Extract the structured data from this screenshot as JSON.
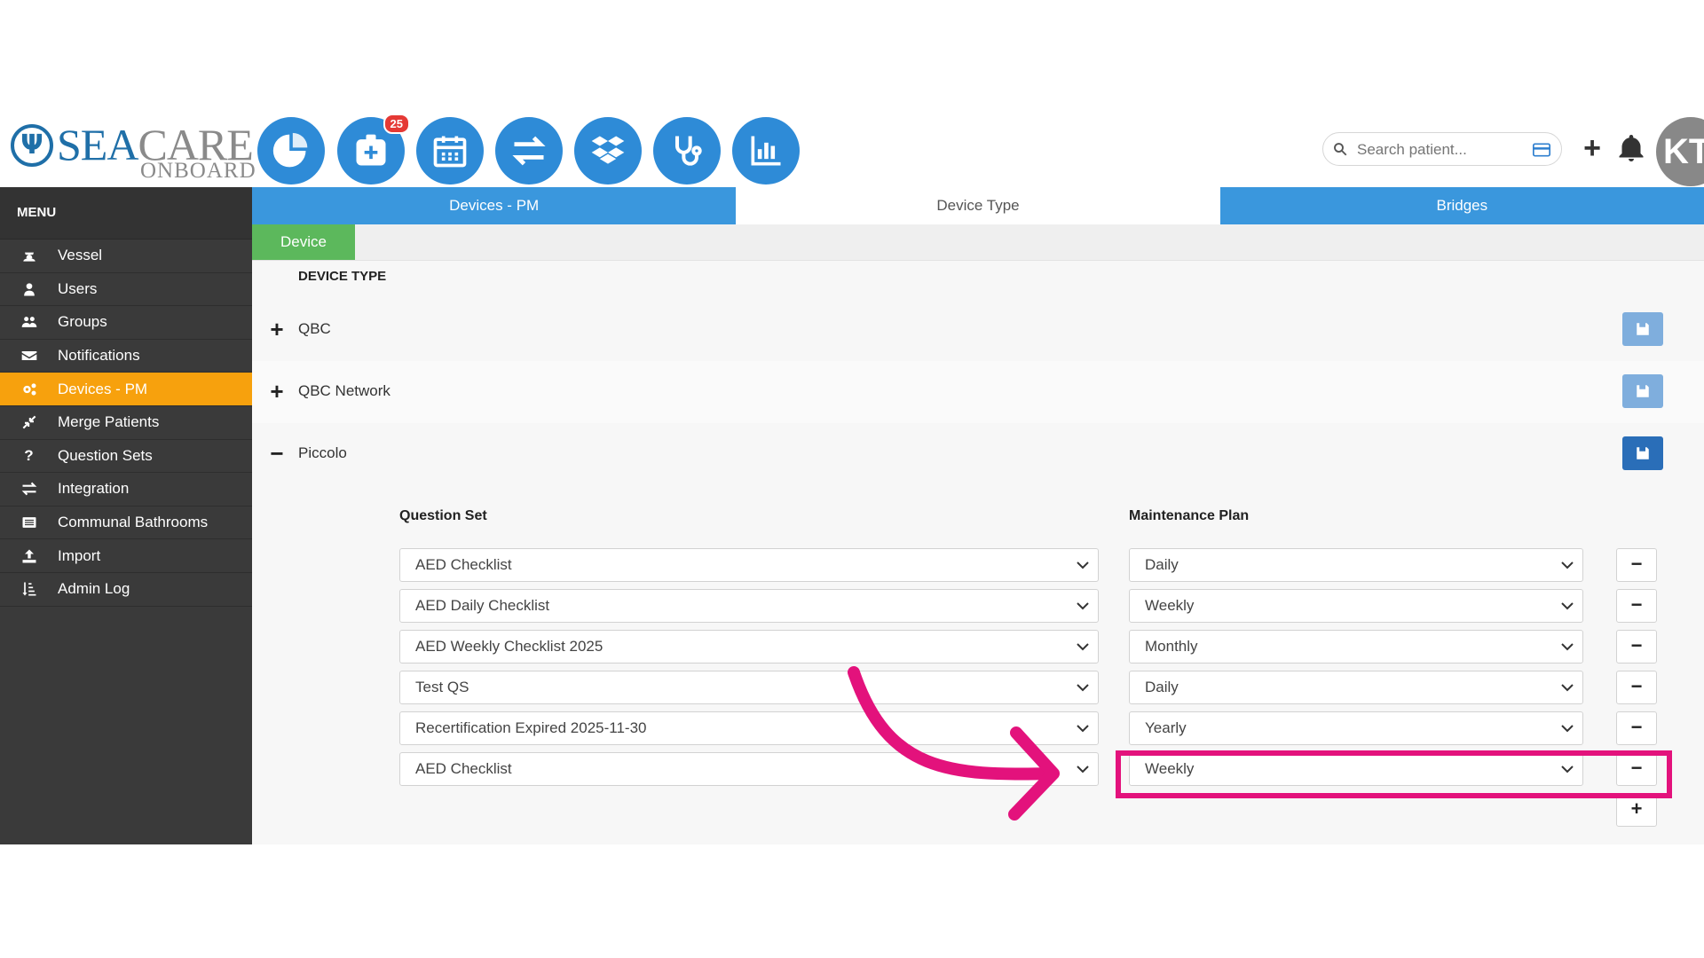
{
  "logo": {
    "sea": "SEA",
    "care": "CARE",
    "onboard": "ONBOARD",
    "emblem": "Ψ"
  },
  "nav_icons": [
    {
      "name": "dashboard-pie-icon"
    },
    {
      "name": "medical-add-icon",
      "badge": "25"
    },
    {
      "name": "calendar-icon"
    },
    {
      "name": "transfer-arrows-icon"
    },
    {
      "name": "dropbox-icon"
    },
    {
      "name": "stethoscope-icon"
    },
    {
      "name": "bar-chart-icon"
    }
  ],
  "search": {
    "placeholder": "Search patient..."
  },
  "user": {
    "initials": "KT"
  },
  "menu": {
    "title": "MENU",
    "items": [
      {
        "label": "Vessel",
        "icon": "captain-icon"
      },
      {
        "label": "Users",
        "icon": "user-icon"
      },
      {
        "label": "Groups",
        "icon": "group-icon"
      },
      {
        "label": "Notifications",
        "icon": "envelope-icon"
      },
      {
        "label": "Devices - PM",
        "icon": "cogs-icon",
        "active": true
      },
      {
        "label": "Merge Patients",
        "icon": "compress-icon"
      },
      {
        "label": "Question Sets",
        "icon": "question-icon"
      },
      {
        "label": "Integration",
        "icon": "exchange-icon"
      },
      {
        "label": "Communal Bathrooms",
        "icon": "list-alt-icon"
      },
      {
        "label": "Import",
        "icon": "upload-icon"
      },
      {
        "label": "Admin Log",
        "icon": "sort-icon"
      }
    ]
  },
  "tabs": [
    "Devices - PM",
    "Device Type",
    "Bridges"
  ],
  "subtab": "Device",
  "device_type_header": "DEVICE TYPE",
  "device_types": [
    {
      "name": "QBC",
      "toggle": "+"
    },
    {
      "name": "QBC Network",
      "toggle": "+"
    },
    {
      "name": "Piccolo",
      "toggle": "−"
    }
  ],
  "columns": {
    "question_set": "Question Set",
    "maintenance_plan": "Maintenance Plan"
  },
  "rows": [
    {
      "question_set": "AED Checklist",
      "plan": "Daily"
    },
    {
      "question_set": "AED Daily Checklist",
      "plan": "Weekly"
    },
    {
      "question_set": "AED Weekly Checklist 2025",
      "plan": "Monthly"
    },
    {
      "question_set": "Test QS",
      "plan": "Daily"
    },
    {
      "question_set": "Recertification Expired 2025-11-30",
      "plan": "Yearly"
    },
    {
      "question_set": "AED Checklist",
      "plan": "Weekly"
    }
  ],
  "buttons": {
    "remove": "−",
    "add": "+"
  },
  "colors": {
    "primary": "#3a97dd",
    "active_menu": "#f7a10d",
    "subtab": "#5cb85c",
    "highlight": "#e3127c"
  }
}
